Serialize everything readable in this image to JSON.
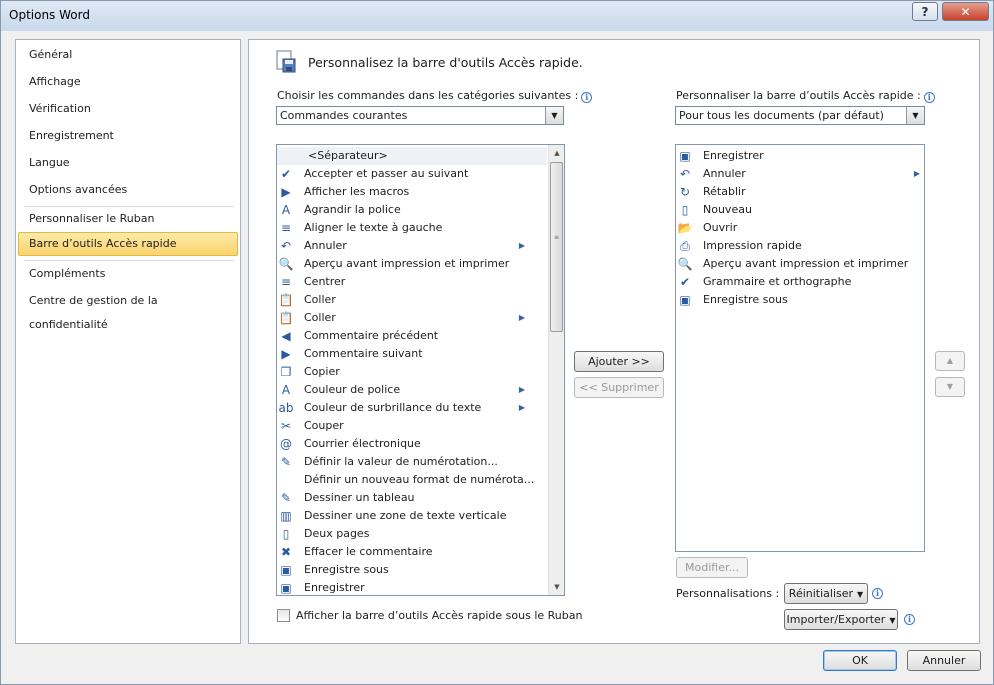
{
  "window": {
    "title": "Options Word",
    "help_label": "?",
    "close_label": "✕"
  },
  "nav": {
    "items": [
      {
        "label": "Général"
      },
      {
        "label": "Affichage"
      },
      {
        "label": "Vérification"
      },
      {
        "label": "Enregistrement"
      },
      {
        "label": "Langue"
      },
      {
        "label": "Options avancées"
      },
      {
        "label": "Personnaliser le Ruban"
      },
      {
        "label": "Barre d’outils Accès rapide"
      },
      {
        "label": "Compléments"
      },
      {
        "label": "Centre de gestion de la confidentialité"
      }
    ],
    "selected": "Barre d’outils Accès rapide"
  },
  "main": {
    "header": "Personnalisez la barre d'outils Accès rapide.",
    "choose_label": "Choisir les commandes dans les catégories suivantes :",
    "choose_value": "Commandes courantes",
    "customize_label": "Personnaliser la barre d’outils Accès rapide :",
    "customize_value": "Pour tous les documents (par défaut)",
    "left_list": [
      {
        "label": "<Séparateur>",
        "icon": "none"
      },
      {
        "label": "Accepter et passer au suivant",
        "icon": "✔"
      },
      {
        "label": "Afficher les macros",
        "icon": "▶"
      },
      {
        "label": "Agrandir la police",
        "icon": "A"
      },
      {
        "label": "Aligner le texte à gauche",
        "icon": "≡"
      },
      {
        "label": "Annuler",
        "icon": "↶"
      },
      {
        "label": "Aperçu avant impression et imprimer",
        "icon": "🔍"
      },
      {
        "label": "Centrer",
        "icon": "≡"
      },
      {
        "label": "Coller",
        "icon": "📋"
      },
      {
        "label": "Coller",
        "icon": "📋"
      },
      {
        "label": "Commentaire précédent",
        "icon": "◀"
      },
      {
        "label": "Commentaire suivant",
        "icon": "▶"
      },
      {
        "label": "Copier",
        "icon": "❐"
      },
      {
        "label": "Couleur de police",
        "icon": "A"
      },
      {
        "label": "Couleur de surbrillance du texte",
        "icon": "ab"
      },
      {
        "label": "Couper",
        "icon": "✂"
      },
      {
        "label": "Courrier électronique",
        "icon": "@"
      },
      {
        "label": "Définir la valeur de numérotation...",
        "icon": "✎"
      },
      {
        "label": "Définir un nouveau format de numérota...",
        "icon": "none"
      },
      {
        "label": "Dessiner un tableau",
        "icon": "✎"
      },
      {
        "label": "Dessiner une zone de texte verticale",
        "icon": "▥"
      },
      {
        "label": "Deux pages",
        "icon": "▯"
      },
      {
        "label": "Effacer le commentaire",
        "icon": "✖"
      },
      {
        "label": "Enregistre sous",
        "icon": "▣"
      },
      {
        "label": "Enregistrer",
        "icon": "▣"
      }
    ],
    "right_list": [
      {
        "label": "Enregistrer",
        "icon": "▣"
      },
      {
        "label": "Annuler",
        "icon": "↶"
      },
      {
        "label": "Rétablir",
        "icon": "↻"
      },
      {
        "label": "Nouveau",
        "icon": "▯"
      },
      {
        "label": "Ouvrir",
        "icon": "📂"
      },
      {
        "label": "Impression rapide",
        "icon": "⎙"
      },
      {
        "label": "Aperçu avant impression et imprimer",
        "icon": "🔍"
      },
      {
        "label": "Grammaire et orthographe",
        "icon": "✔"
      },
      {
        "label": "Enregistre sous",
        "icon": "▣"
      }
    ],
    "add_button": "Ajouter >>",
    "remove_button": "<< Supprimer",
    "modify_button": "Modifier...",
    "personalisations_label": "Personnalisations :",
    "reset_button": "Réinitialiser",
    "import_export_button": "Importer/Exporter",
    "show_below_label": "Afficher la barre d’outils Accès rapide sous le Ruban"
  },
  "footer": {
    "ok": "OK",
    "cancel": "Annuler"
  },
  "colors": {
    "selection": "#fbd56c",
    "accent": "#3b79c7"
  }
}
